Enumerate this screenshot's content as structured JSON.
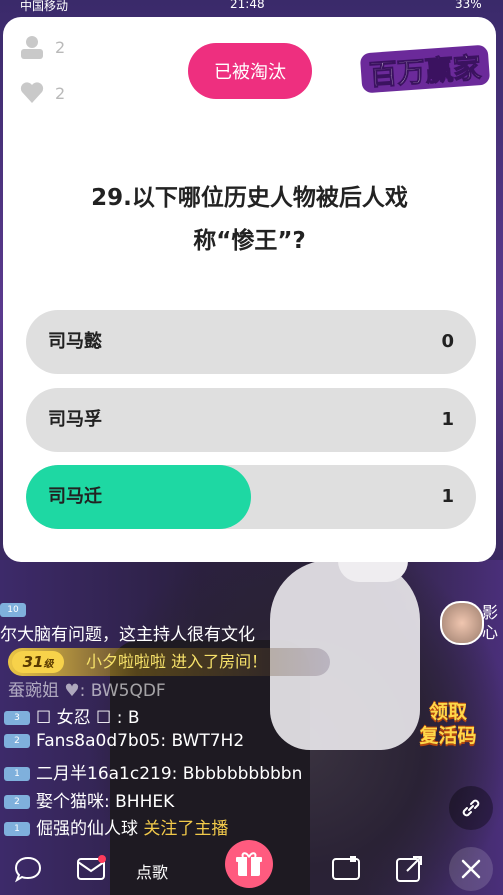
{
  "status_bar": {
    "carrier": "中国移动",
    "time": "21:48",
    "battery": "33%"
  },
  "stats": {
    "viewers": "2",
    "likes": "2"
  },
  "eliminated_label": "已被淘汰",
  "logo_text": "百万赢家",
  "question": {
    "line1": "29.以下哪位历史人物被后人戏",
    "line2": "称“惨王”?"
  },
  "options": [
    {
      "label": "司马懿",
      "count": "0",
      "ratio": 0
    },
    {
      "label": "司马孚",
      "count": "1",
      "ratio": 0
    },
    {
      "label": "司马迁",
      "count": "1",
      "ratio": 0.5
    }
  ],
  "side": {
    "text1": "影",
    "text2": "心"
  },
  "chat": {
    "line0_level": "10",
    "line0_text": "尔大脑有问题，这主持人很有文化",
    "enter_level": "31",
    "enter_level_suffix": "级",
    "enter_text": "小夕啦啦啦  进入了房间！",
    "line2_text": "蚕豌姐 ♥: BW5QDF",
    "rows": [
      {
        "level": "3",
        "text": "☐ 女忍 ☐ : B"
      },
      {
        "level": "2",
        "text": "Fans8a0d7b05: BWT7H2"
      },
      {
        "level": "1",
        "text": "二月半16a1c219: Bbbbbbbbbbn"
      },
      {
        "level": "2",
        "text": "娶个猫咪: BHHEK"
      },
      {
        "level": "1",
        "text": "倔强的仙人球 ",
        "follow": "关注了主播"
      }
    ]
  },
  "promo": {
    "line1": "领取",
    "line2": "复活码"
  },
  "bottom": {
    "song_label": "点歌"
  },
  "colors": {
    "accent_pink": "#ee2f7f",
    "selected_green": "#1ed8a3",
    "option_grey": "#dfdfdf"
  }
}
